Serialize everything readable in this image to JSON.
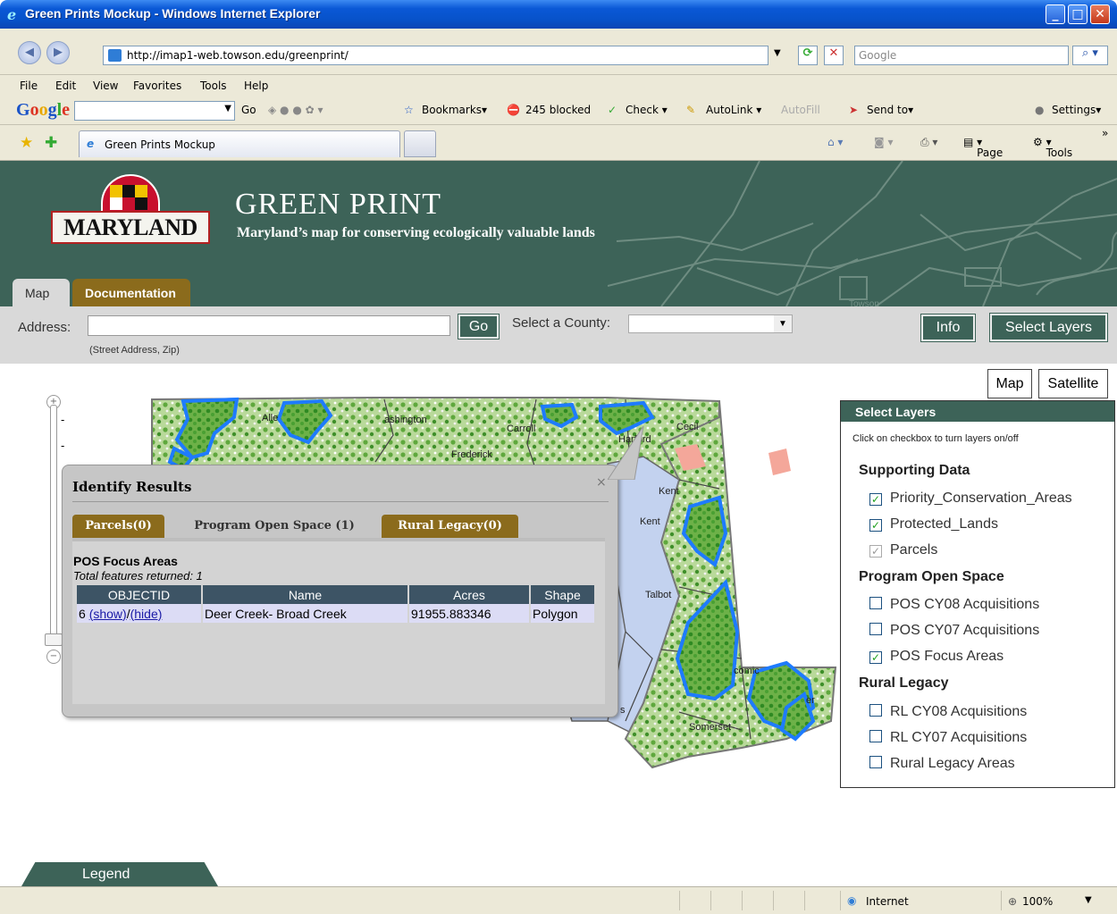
{
  "window": {
    "title": "Green Prints Mockup - Windows Internet Explorer"
  },
  "browser": {
    "url": "http://imap1-web.towson.edu/greenprint/",
    "search_placeholder": "Google",
    "menu": [
      "File",
      "Edit",
      "View",
      "Favorites",
      "Tools",
      "Help"
    ],
    "google_toolbar": {
      "logo": "Google",
      "go_label": "Go",
      "bookmarks": "Bookmarks",
      "blocked": "245 blocked",
      "check": "Check",
      "autolink": "AutoLink",
      "autofill": "AutoFill",
      "send_to": "Send to",
      "settings": "Settings"
    },
    "tab_title": "Green Prints Mockup",
    "command_bar": {
      "page": "Page",
      "tools": "Tools"
    },
    "status": {
      "zone": "Internet",
      "zoom": "100%"
    }
  },
  "header": {
    "logo_text": "MARYLAND",
    "title": "GREEN PRINT",
    "subtitle": "Maryland’s map for conserving ecologically valuable lands",
    "street_label": "Towson",
    "tabs": {
      "map": "Map",
      "documentation": "Documentation"
    }
  },
  "toolbar": {
    "address_label": "Address:",
    "address_hint": "(Street Address, Zip)",
    "go": "Go",
    "county_label": "Select a County:",
    "info": "Info",
    "select_layers": "Select Layers"
  },
  "map": {
    "type_map": "Map",
    "type_satellite": "Satellite",
    "labels": {
      "allegany": "Alle",
      "washington": "ashington",
      "carroll": "Carroll",
      "harford": "Harford",
      "cecil": "Cecil",
      "frederick": "Frederick",
      "kent": "Kent",
      "kent2": "Kent",
      "talbot": "Talbot",
      "wicomico": "comic",
      "worcester": "er",
      "somerset": "Somerset",
      "s": "s"
    },
    "legend": "Legend"
  },
  "layers": {
    "title": "Select Layers",
    "hint": "Click on checkbox to turn layers on/off",
    "groups": [
      {
        "name": "Supporting Data",
        "items": [
          {
            "label": "Priority_Conservation_Areas",
            "checked": true
          },
          {
            "label": "Protected_Lands",
            "checked": true
          },
          {
            "label": "Parcels",
            "checked": true,
            "disabled": true
          }
        ]
      },
      {
        "name": "Program Open Space",
        "items": [
          {
            "label": "POS CY08 Acquisitions",
            "checked": false
          },
          {
            "label": "POS CY07 Acquisitions",
            "checked": false
          },
          {
            "label": "POS Focus Areas",
            "checked": true
          }
        ]
      },
      {
        "name": "Rural Legacy",
        "items": [
          {
            "label": "RL CY08 Acquisitions",
            "checked": false
          },
          {
            "label": "RL CY07 Acquisitions",
            "checked": false
          },
          {
            "label": "Rural Legacy Areas",
            "checked": false
          }
        ]
      }
    ]
  },
  "identify": {
    "title": "Identify Results",
    "close": "×",
    "tabs": [
      "Parcels(0)",
      "Program Open Space (1)",
      "Rural Legacy(0)"
    ],
    "result_title": "POS Focus Areas",
    "result_count": "Total features returned: 1",
    "columns": [
      "OBJECTID",
      "Name",
      "Acres",
      "Shape"
    ],
    "row": {
      "id": "6",
      "show": "(show)",
      "slash": "/",
      "hide": "(hide)",
      "name": "Deer Creek- Broad Creek",
      "acres": "91955.883346",
      "shape": "Polygon"
    }
  },
  "colors": {
    "brand_green": "#3d6358",
    "tab_gold": "#8b6b1c",
    "focus_outline": "#1e7bff",
    "land_green": "#8fc46a",
    "water": "#c3d2ef"
  }
}
